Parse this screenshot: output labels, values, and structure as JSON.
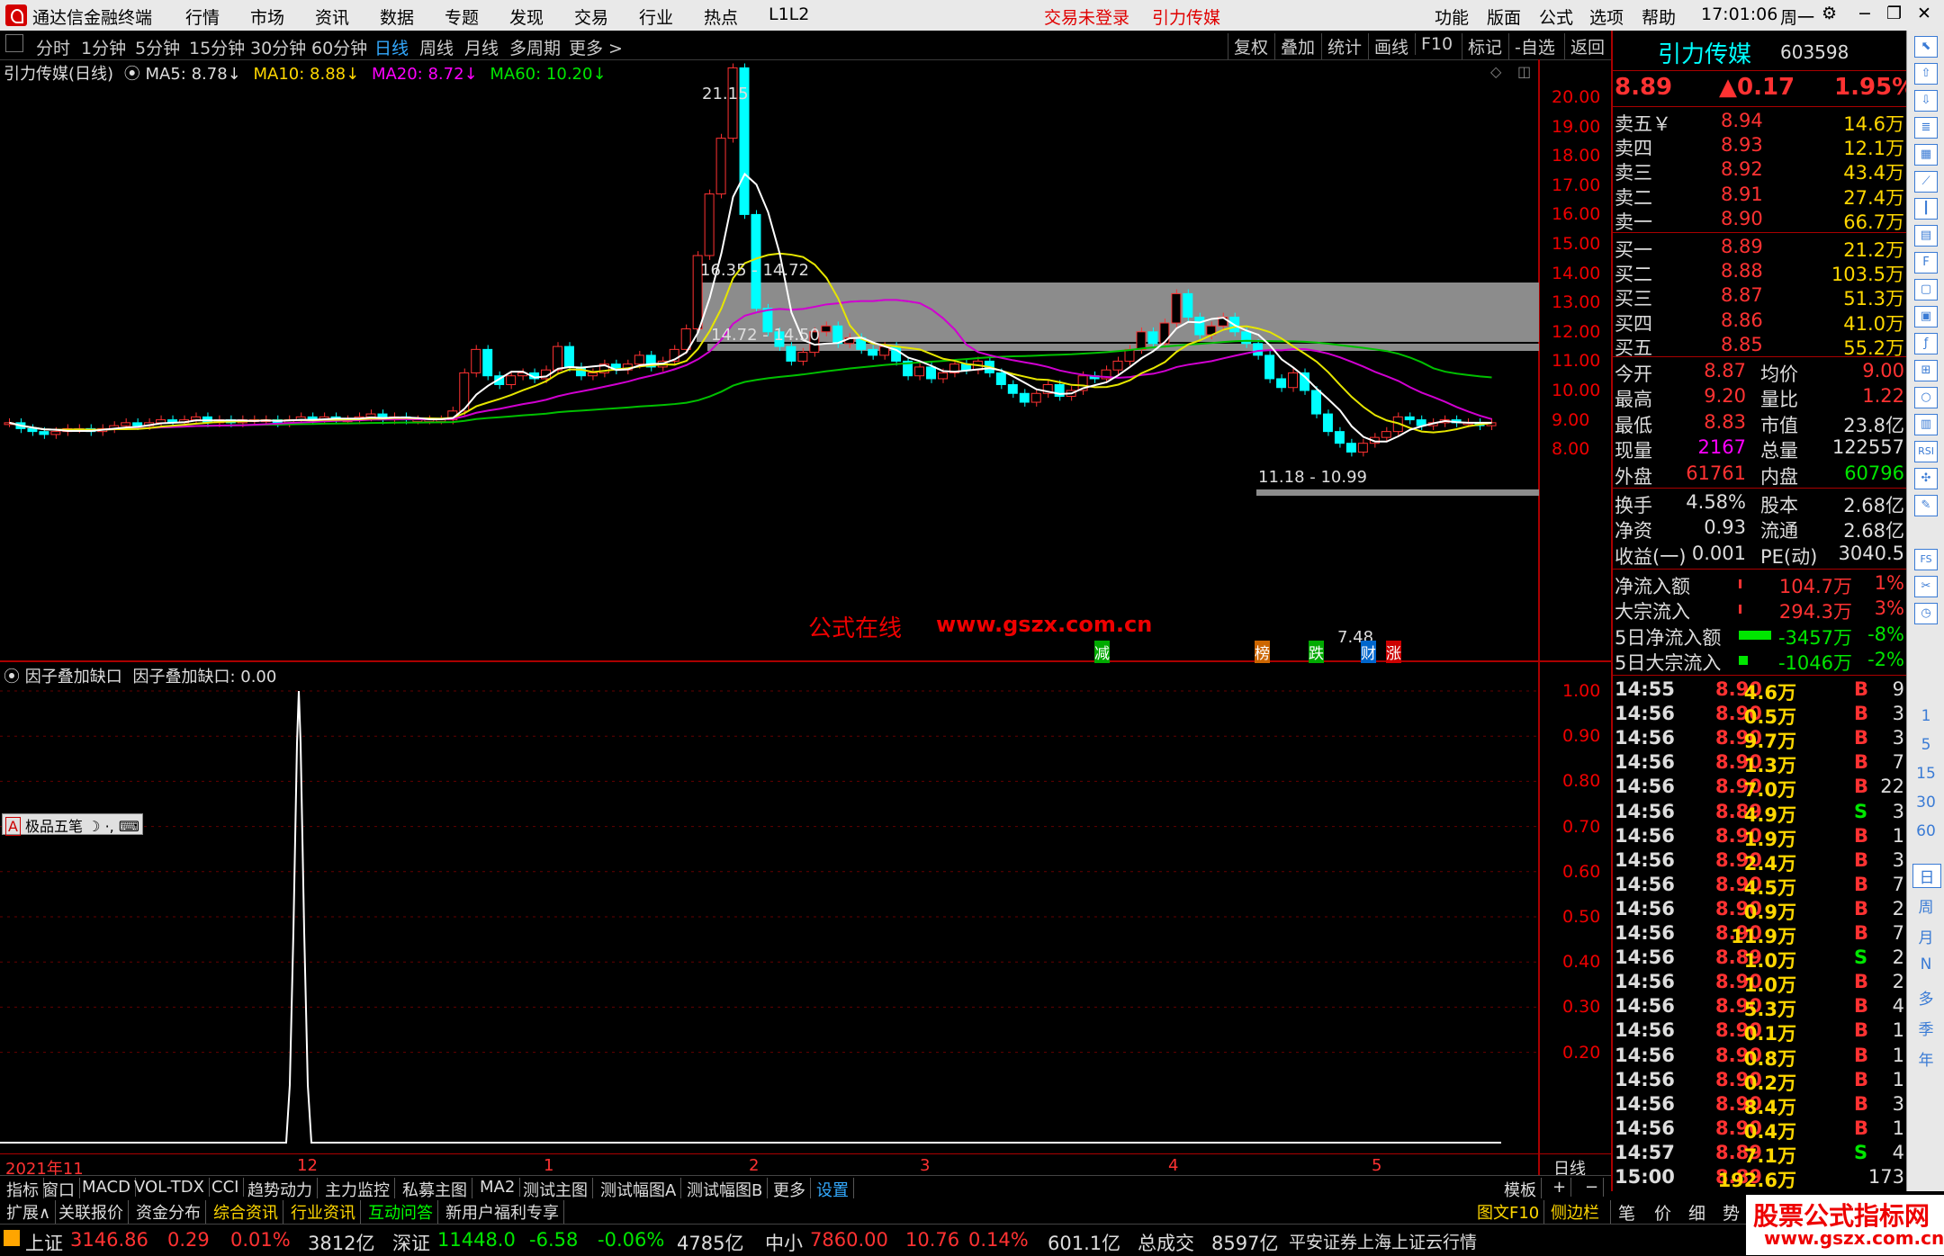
{
  "menubar": {
    "app_title": "通达信金融终端",
    "items": [
      "行情",
      "市场",
      "资讯",
      "数据",
      "专题",
      "发现",
      "交易",
      "行业",
      "热点",
      "L1L2"
    ],
    "status_red": [
      "交易未登录",
      "引力传媒"
    ],
    "right_items": [
      "功能",
      "版面",
      "公式",
      "选项",
      "帮助"
    ],
    "clock": "17:01:06",
    "weekday": "周一"
  },
  "toolbar": {
    "periods": [
      "分时",
      "1分钟",
      "5分钟",
      "15分钟",
      "30分钟",
      "60分钟",
      "日线",
      "周线",
      "月线",
      "多周期",
      "更多 >"
    ],
    "active": "日线",
    "right": [
      "复权",
      "叠加",
      "统计",
      "画线",
      "F10",
      "标记",
      "-自选",
      "返回"
    ]
  },
  "chart_header": {
    "title": "引力传媒(日线)",
    "ma5": "MA5: 8.78↓",
    "ma10": "MA10: 8.88↓",
    "ma20": "MA20: 8.72↓",
    "ma60": "MA60: 10.20↓"
  },
  "main_chart": {
    "y_ticks": [
      "20.00",
      "19.00",
      "18.00",
      "17.00",
      "16.00",
      "15.00",
      "14.00",
      "13.00",
      "12.00",
      "11.00",
      "10.00",
      "9.00",
      "8.00"
    ],
    "annotations": {
      "high": "21.15",
      "gap1": "16.35 - 14.72",
      "gap2": "14.72 - 14.50",
      "gap3": "11.18 - 10.99",
      "low": "7.48"
    },
    "watermark_cn": "公式在线",
    "watermark_url": "www.gszx.com.cn",
    "markers": [
      "减",
      "榜",
      "跌",
      "财",
      "涨"
    ]
  },
  "sub_chart": {
    "title": "因子叠加缺口",
    "value_label": "因子叠加缺口: 0.00",
    "y_ticks": [
      "1.00",
      "0.90",
      "0.80",
      "0.70",
      "0.60",
      "0.50",
      "0.40",
      "0.30",
      "0.20"
    ],
    "ime_label": "极品五笔"
  },
  "x_axis": {
    "labels": [
      "2021年11",
      "12",
      "1",
      "2",
      "3",
      "4",
      "5"
    ],
    "period_label": "日线"
  },
  "quote": {
    "name": "引力传媒",
    "code": "603598",
    "price": "8.89",
    "change": "▲0.17",
    "pct": "1.95%",
    "asks": [
      {
        "label": "卖五￥",
        "price": "8.94",
        "vol": "14.6万"
      },
      {
        "label": "卖四",
        "price": "8.93",
        "vol": "12.1万"
      },
      {
        "label": "卖三",
        "price": "8.92",
        "vol": "43.4万"
      },
      {
        "label": "卖二",
        "price": "8.91",
        "vol": "27.4万"
      },
      {
        "label": "卖一",
        "price": "8.90",
        "vol": "66.7万"
      }
    ],
    "bids": [
      {
        "label": "买一",
        "price": "8.89",
        "vol": "21.2万"
      },
      {
        "label": "买二",
        "price": "8.88",
        "vol": "103.5万"
      },
      {
        "label": "买三",
        "price": "8.87",
        "vol": "51.3万"
      },
      {
        "label": "买四",
        "price": "8.86",
        "vol": "41.0万"
      },
      {
        "label": "买五",
        "price": "8.85",
        "vol": "55.2万"
      }
    ],
    "stats": [
      {
        "l1": "今开",
        "v1": "8.87",
        "c1": "red",
        "l2": "均价",
        "v2": "9.00",
        "c2": "red"
      },
      {
        "l1": "最高",
        "v1": "9.20",
        "c1": "red",
        "l2": "量比",
        "v2": "1.22",
        "c2": "red"
      },
      {
        "l1": "最低",
        "v1": "8.83",
        "c1": "red",
        "l2": "市值",
        "v2": "23.8亿",
        "c2": "white"
      },
      {
        "l1": "现量",
        "v1": "2167",
        "c1": "mag",
        "l2": "总量",
        "v2": "122557",
        "c2": "white"
      },
      {
        "l1": "外盘",
        "v1": "61761",
        "c1": "red",
        "l2": "内盘",
        "v2": "60796",
        "c2": "green"
      }
    ],
    "stats2": [
      {
        "l1": "换手",
        "v1": "4.58%",
        "l2": "股本",
        "v2": "2.68亿"
      },
      {
        "l1": "净资",
        "v1": "0.93",
        "l2": "流通",
        "v2": "2.68亿"
      },
      {
        "l1": "收益(一)",
        "v1": "0.001",
        "l2": "PE(动)",
        "v2": "3040.5"
      }
    ],
    "flows": [
      {
        "label": "净流入额",
        "val": "104.7万",
        "pct": "1%",
        "color": "red"
      },
      {
        "label": "大宗流入",
        "val": "294.3万",
        "pct": "3%",
        "color": "red"
      },
      {
        "label": "5日净流入额",
        "val": "-3457万",
        "pct": "-8%",
        "color": "green"
      },
      {
        "label": "5日大宗流入",
        "val": "-1046万",
        "pct": "-2%",
        "color": "green"
      }
    ],
    "ticks": [
      {
        "t": "14:55",
        "p": "8.90",
        "v": "4.6万",
        "s": "B",
        "n": "9"
      },
      {
        "t": "14:56",
        "p": "8.90",
        "v": "0.5万",
        "s": "B",
        "n": "3"
      },
      {
        "t": "14:56",
        "p": "8.90",
        "v": "9.7万",
        "s": "B",
        "n": "3"
      },
      {
        "t": "14:56",
        "p": "8.90",
        "v": "1.3万",
        "s": "B",
        "n": "7"
      },
      {
        "t": "14:56",
        "p": "8.90",
        "v": "7.0万",
        "s": "B",
        "n": "22"
      },
      {
        "t": "14:56",
        "p": "8.89",
        "v": "4.9万",
        "s": "S",
        "n": "3"
      },
      {
        "t": "14:56",
        "p": "8.90",
        "v": "1.9万",
        "s": "B",
        "n": "1"
      },
      {
        "t": "14:56",
        "p": "8.90",
        "v": "2.4万",
        "s": "B",
        "n": "3"
      },
      {
        "t": "14:56",
        "p": "8.90",
        "v": "4.5万",
        "s": "B",
        "n": "7"
      },
      {
        "t": "14:56",
        "p": "8.90",
        "v": "0.9万",
        "s": "B",
        "n": "2"
      },
      {
        "t": "14:56",
        "p": "8.90",
        "v": "11.9万",
        "s": "B",
        "n": "7"
      },
      {
        "t": "14:56",
        "p": "8.89",
        "v": "1.0万",
        "s": "S",
        "n": "2"
      },
      {
        "t": "14:56",
        "p": "8.90",
        "v": "1.0万",
        "s": "B",
        "n": "2"
      },
      {
        "t": "14:56",
        "p": "8.90",
        "v": "5.3万",
        "s": "B",
        "n": "4"
      },
      {
        "t": "14:56",
        "p": "8.90",
        "v": "0.1万",
        "s": "B",
        "n": "1"
      },
      {
        "t": "14:56",
        "p": "8.90",
        "v": "0.8万",
        "s": "B",
        "n": "1"
      },
      {
        "t": "14:56",
        "p": "8.90",
        "v": "0.2万",
        "s": "B",
        "n": "1"
      },
      {
        "t": "14:56",
        "p": "8.90",
        "v": "8.4万",
        "s": "B",
        "n": "3"
      },
      {
        "t": "14:56",
        "p": "8.90",
        "v": "0.4万",
        "s": "B",
        "n": "1"
      },
      {
        "t": "14:57",
        "p": "8.89",
        "v": "7.1万",
        "s": "S",
        "n": "4"
      },
      {
        "t": "15:00",
        "p": "8.89",
        "v": "192.6万",
        "s": "",
        "n": "173"
      }
    ]
  },
  "tabs_row1": [
    "指标",
    "窗口",
    "MACD",
    "VOL-TDX",
    "CCI",
    "趋势动力",
    "主力监控",
    "私募主图",
    "MA2",
    "测试主图",
    "测试幅图A",
    "测试幅图B",
    "更多",
    "设置"
  ],
  "tabs_row1_right": [
    "模板",
    "+",
    "−"
  ],
  "tabs_row2": [
    "扩展∧",
    "关联报价",
    "资金分布",
    "综合资讯",
    "行业资讯",
    "互动问答",
    "新用户福利专享"
  ],
  "tabs_row2_right": [
    "图文F10",
    "侧边栏《",
    "笔",
    "价",
    "细",
    "势"
  ],
  "statusbar": {
    "sh_label": "上证",
    "sh_val": "3146.86",
    "sh_chg": "0.29",
    "sh_pct": "0.01%",
    "sh_amt": "3812亿",
    "sz_label": "深证",
    "sz_val": "11448.0",
    "sz_chg": "-6.58",
    "sz_pct": "-0.06%",
    "sz_amt": "4785亿",
    "zx_label": "中小",
    "zx_val": "7860.00",
    "zx_chg": "10.76",
    "zx_pct": "0.14%",
    "zx_amt": "601.1亿",
    "total_label": "总成交",
    "total_val": "8597亿",
    "broker": "平安证券上海上证云行情"
  },
  "sidebar_labels": [
    "1",
    "5",
    "15",
    "30",
    "60",
    "日",
    "周",
    "月",
    "N",
    "多",
    "季",
    "年"
  ],
  "sidebar_tags": [
    "RSI",
    "FS"
  ],
  "brand_watermark": {
    "line1": "股票公式指标网",
    "line2": "www.gszx.com.cn"
  }
}
